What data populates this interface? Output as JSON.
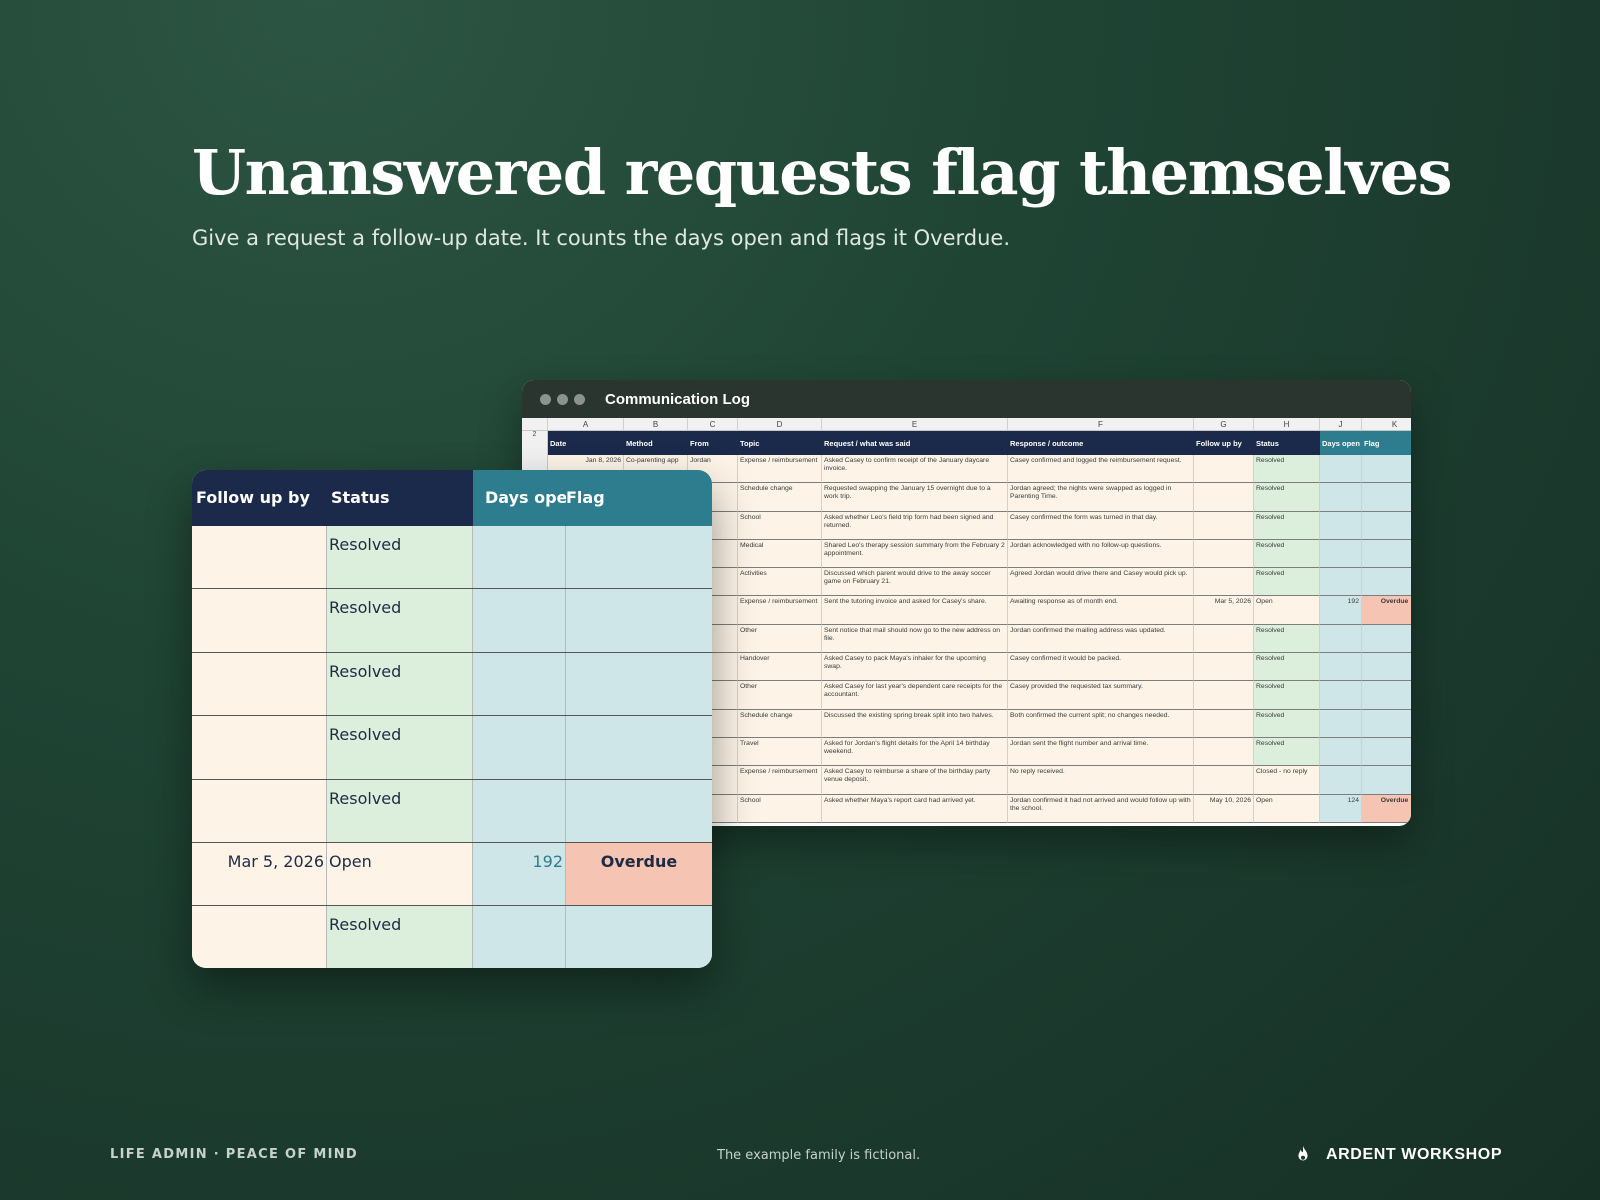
{
  "headline": "Unanswered requests flag themselves",
  "subhead": "Give a request a follow-up date. It counts the days open and flags it Overdue.",
  "window": {
    "title": "Communication Log",
    "col_letters": [
      "",
      "A",
      "B",
      "C",
      "D",
      "E",
      "F",
      "G",
      "H",
      "J",
      "K"
    ],
    "header_row_number": "2",
    "headers": [
      "Date",
      "Method",
      "From",
      "Topic",
      "Request / what was said",
      "Response / outcome",
      "Follow up by",
      "Status",
      "Days open",
      "Flag"
    ],
    "rows": [
      {
        "date": "Jan 8, 2026",
        "method": "Co-parenting app",
        "from": "Jordan",
        "topic": "Expense / reimbursement",
        "request": "Asked Casey to confirm receipt of the January daycare invoice.",
        "response": "Casey confirmed and logged the reimbursement request.",
        "follow": "",
        "status": "Resolved",
        "days": "",
        "flag": ""
      },
      {
        "date": "",
        "method": "",
        "from": "",
        "topic": "Schedule change",
        "request": "Requested swapping the January 15 overnight due to a work trip.",
        "response": "Jordan agreed; the nights were swapped as logged in Parenting Time.",
        "follow": "",
        "status": "Resolved",
        "days": "",
        "flag": ""
      },
      {
        "date": "",
        "method": "",
        "from": "",
        "topic": "School",
        "request": "Asked whether Leo's field trip form had been signed and returned.",
        "response": "Casey confirmed the form was turned in that day.",
        "follow": "",
        "status": "Resolved",
        "days": "",
        "flag": ""
      },
      {
        "date": "",
        "method": "",
        "from": "",
        "topic": "Medical",
        "request": "Shared Leo's therapy session summary from the February 2 appointment.",
        "response": "Jordan acknowledged with no follow-up questions.",
        "follow": "",
        "status": "Resolved",
        "days": "",
        "flag": ""
      },
      {
        "date": "",
        "method": "",
        "from": "",
        "topic": "Activities",
        "request": "Discussed which parent would drive to the away soccer game on February 21.",
        "response": "Agreed Jordan would drive there and Casey would pick up.",
        "follow": "",
        "status": "Resolved",
        "days": "",
        "flag": ""
      },
      {
        "date": "",
        "method": "",
        "from": "",
        "topic": "Expense / reimbursement",
        "request": "Sent the tutoring invoice and asked for Casey's share.",
        "response": "Awaiting response as of month end.",
        "follow": "Mar 5, 2026",
        "status": "Open",
        "days": "192",
        "flag": "Overdue"
      },
      {
        "date": "",
        "method": "",
        "from": "",
        "topic": "Other",
        "request": "Sent notice that mail should now go to the new address on file.",
        "response": "Jordan confirmed the mailing address was updated.",
        "follow": "",
        "status": "Resolved",
        "days": "",
        "flag": ""
      },
      {
        "date": "",
        "method": "",
        "from": "",
        "topic": "Handover",
        "request": "Asked Casey to pack Maya's inhaler for the upcoming swap.",
        "response": "Casey confirmed it would be packed.",
        "follow": "",
        "status": "Resolved",
        "days": "",
        "flag": ""
      },
      {
        "date": "",
        "method": "",
        "from": "",
        "topic": "Other",
        "request": "Asked Casey for last year's dependent care receipts for the accountant.",
        "response": "Casey provided the requested tax summary.",
        "follow": "",
        "status": "Resolved",
        "days": "",
        "flag": ""
      },
      {
        "date": "",
        "method": "",
        "from": "",
        "topic": "Schedule change",
        "request": "Discussed the existing spring break split into two halves.",
        "response": "Both confirmed the current split; no changes needed.",
        "follow": "",
        "status": "Resolved",
        "days": "",
        "flag": ""
      },
      {
        "date": "",
        "method": "",
        "from": "",
        "topic": "Travel",
        "request": "Asked for Jordan's flight details for the April 14 birthday weekend.",
        "response": "Jordan sent the flight number and arrival time.",
        "follow": "",
        "status": "Resolved",
        "days": "",
        "flag": ""
      },
      {
        "date": "",
        "method": "",
        "from": "",
        "topic": "Expense / reimbursement",
        "request": "Asked Casey to reimburse a share of the birthday party venue deposit.",
        "response": "No reply received.",
        "follow": "",
        "status": "Closed - no reply",
        "days": "",
        "flag": ""
      },
      {
        "date": "",
        "method": "",
        "from": "",
        "topic": "School",
        "request": "Asked whether Maya's report card had arrived yet.",
        "response": "Jordan confirmed it had not arrived and would follow up with the school.",
        "follow": "May 10, 2026",
        "status": "Open",
        "days": "124",
        "flag": "Overdue"
      }
    ]
  },
  "zoom": {
    "headers": [
      "Follow up by",
      "Status",
      "Days open",
      "Flag"
    ],
    "rows": [
      {
        "follow": "",
        "status": "Resolved",
        "days": "",
        "flag": ""
      },
      {
        "follow": "",
        "status": "Resolved",
        "days": "",
        "flag": ""
      },
      {
        "follow": "",
        "status": "Resolved",
        "days": "",
        "flag": ""
      },
      {
        "follow": "",
        "status": "Resolved",
        "days": "",
        "flag": ""
      },
      {
        "follow": "",
        "status": "Resolved",
        "days": "",
        "flag": ""
      },
      {
        "follow": "Mar 5, 2026",
        "status": "Open",
        "days": "192",
        "flag": "Overdue"
      },
      {
        "follow": "",
        "status": "Resolved",
        "days": "",
        "flag": ""
      }
    ]
  },
  "footer": {
    "left": "LIFE ADMIN · PEACE OF MIND",
    "middle": "The example family is fictional.",
    "brand": "ARDENT WORKSHOP",
    "brand_icon": "flame-icon"
  },
  "colors": {
    "navy_header": "#1b2a4a",
    "teal_header": "#2d7d8f",
    "cream_cell": "#fdf4e7",
    "status_green": "#dcefdc",
    "days_blue": "#cfe6e8",
    "overdue_salmon": "#f5c4b3",
    "background": "#1f4434"
  }
}
